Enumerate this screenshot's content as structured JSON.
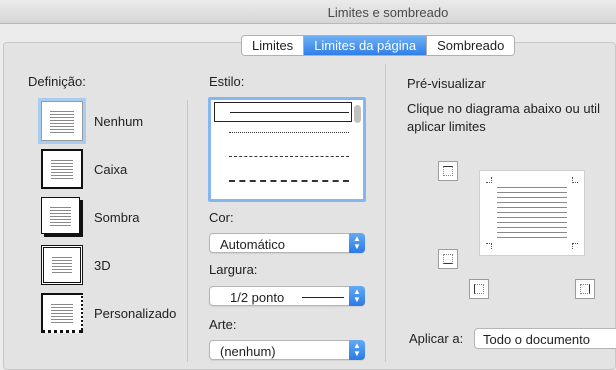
{
  "window": {
    "title": "Limites e sombreado"
  },
  "tabs": [
    {
      "label": "Limites",
      "active": false
    },
    {
      "label": "Limites da página",
      "active": true
    },
    {
      "label": "Sombreado",
      "active": false
    }
  ],
  "definition": {
    "label": "Definição:",
    "items": [
      {
        "label": "Nenhum",
        "selected": true
      },
      {
        "label": "Caixa"
      },
      {
        "label": "Sombra"
      },
      {
        "label": "3D"
      },
      {
        "label": "Personalizado"
      }
    ]
  },
  "style": {
    "label": "Estilo:"
  },
  "color": {
    "label": "Cor:",
    "value": "Automático"
  },
  "width": {
    "label": "Largura:",
    "value": "1/2 ponto"
  },
  "art": {
    "label": "Arte:",
    "value": "(nenhum)"
  },
  "preview": {
    "label": "Pré-visualizar",
    "instruction_line1": "Clique no diagrama abaixo ou util",
    "instruction_line2": "aplicar limites"
  },
  "apply": {
    "label": "Aplicar a:",
    "value": "Todo o documento"
  },
  "colors": {
    "accent": "#2f7fe8",
    "selection": "#a9ccf2"
  }
}
